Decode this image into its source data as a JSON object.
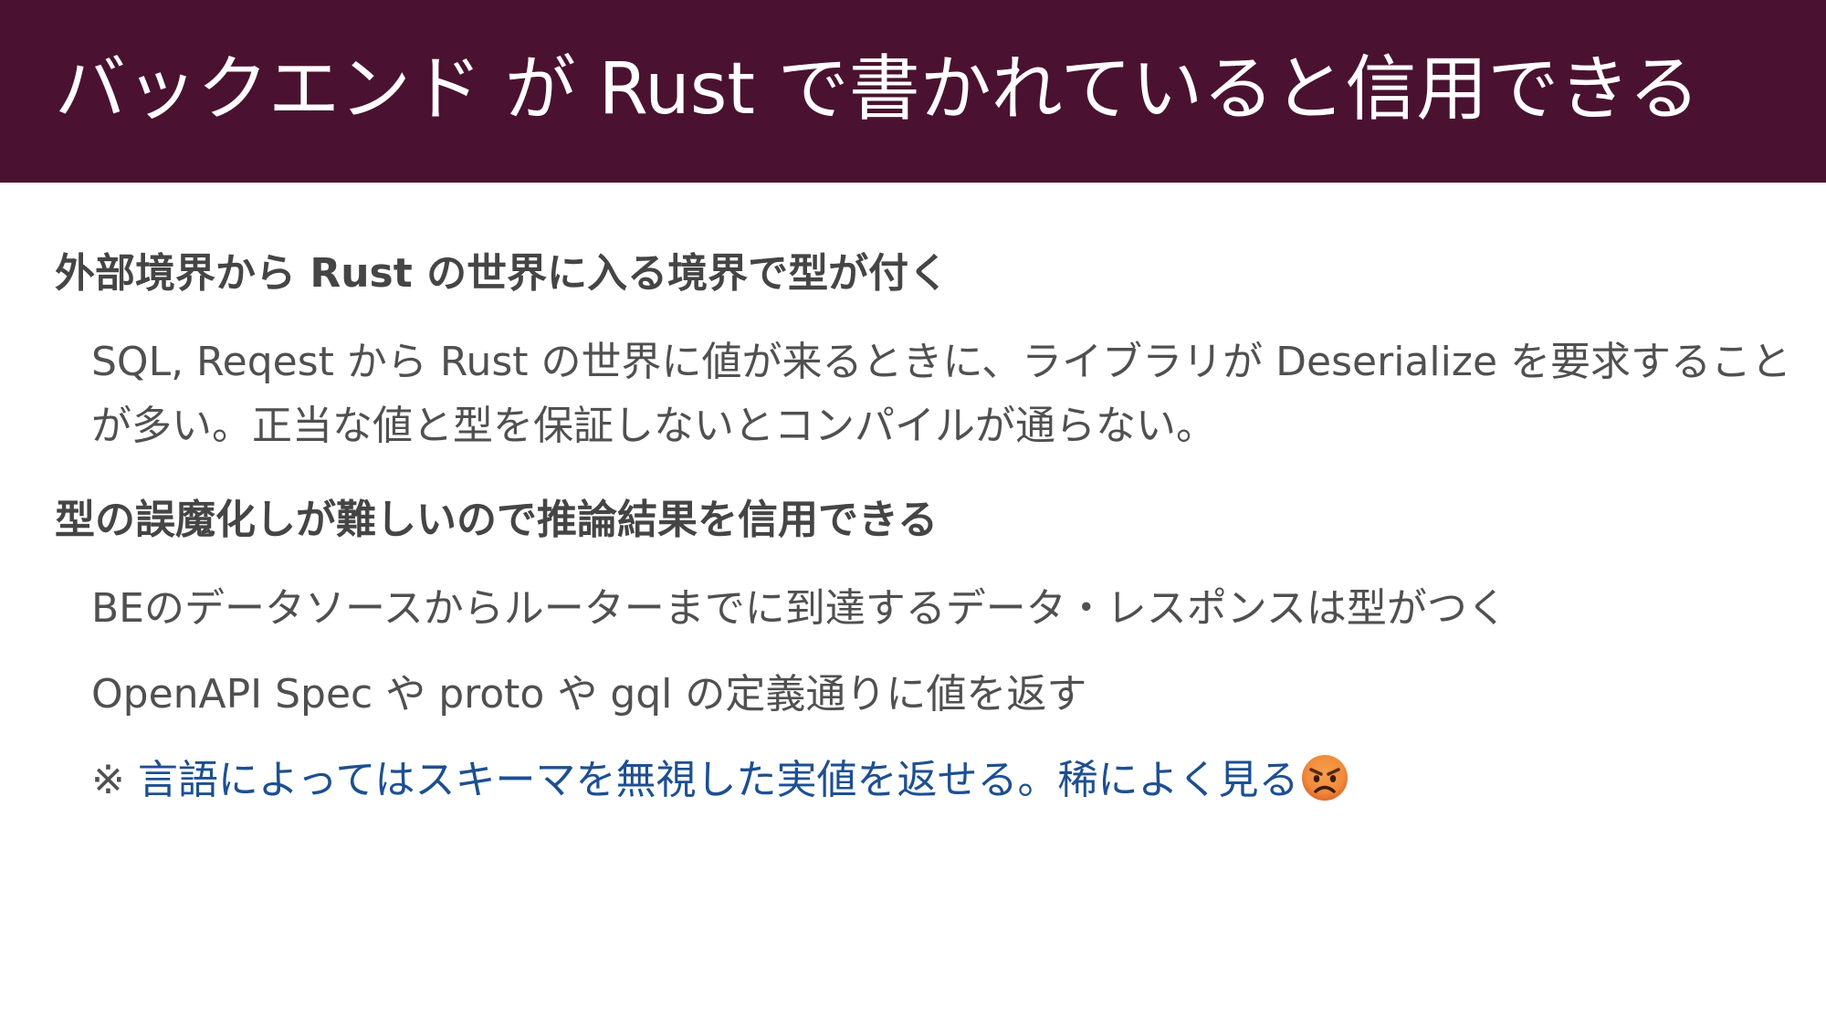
{
  "slide": {
    "title": "バックエンド が Rust で書かれていると信用できる",
    "section1": {
      "heading": "外部境界から Rust の世界に入る境界で型が付く",
      "body": "SQL, Reqest から Rust の世界に値が来るときに、ライブラリが Deserialize を要求することが多い。正当な値と型を保証しないとコンパイルが通らない。"
    },
    "section2": {
      "heading": "型の誤魔化しが難しいので推論結果を信用できる",
      "item1": "BEのデータソースからルーターまでに到達するデータ・レスポンスは型がつく",
      "item2": "OpenAPI Spec や proto や gql の定義通りに値を返す",
      "note_mark": "※",
      "note_text": "言語によってはスキーマを無視した実値を返せる。稀によく見る",
      "note_icon": "angry-face-icon"
    },
    "colors": {
      "title_bar": "#4a1230",
      "title_text": "#ffffff",
      "heading_text": "#454545",
      "body_text": "#505050",
      "note_text": "#1d4f91"
    }
  }
}
